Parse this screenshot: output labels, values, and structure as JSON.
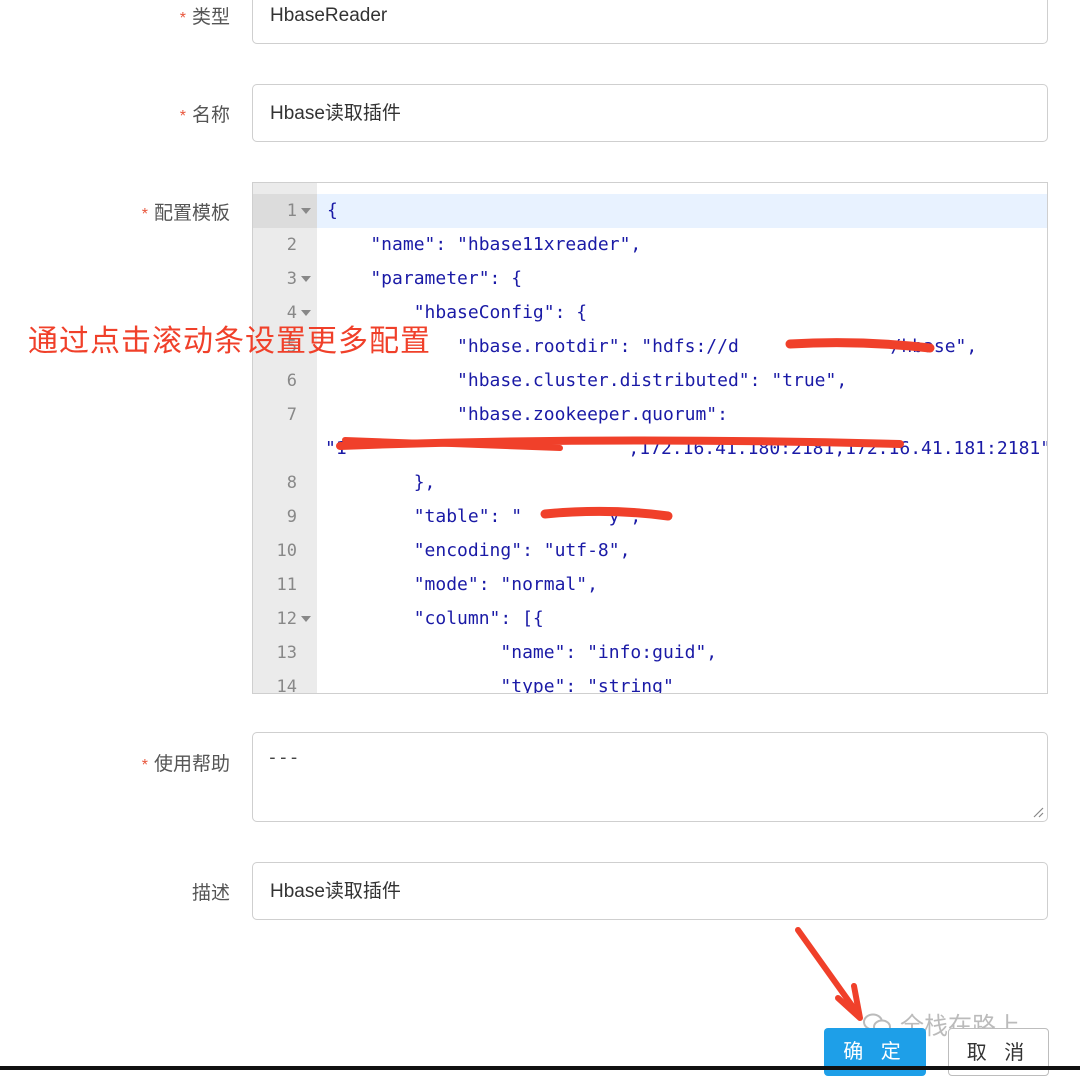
{
  "form": {
    "type": {
      "label": "类型",
      "value": "HbaseReader"
    },
    "name": {
      "label": "名称",
      "value": "Hbase读取插件"
    },
    "template": {
      "label": "配置模板"
    },
    "help": {
      "label": "使用帮助",
      "value": "---"
    },
    "desc": {
      "label": "描述",
      "value": "Hbase读取插件"
    }
  },
  "code_lines": [
    {
      "n": "1",
      "fold": true,
      "text": "{"
    },
    {
      "n": "2",
      "fold": false,
      "text": "    \"name\": \"hbase11xreader\","
    },
    {
      "n": "3",
      "fold": true,
      "text": "    \"parameter\": {"
    },
    {
      "n": "4",
      "fold": true,
      "text": "        \"hbaseConfig\": {"
    },
    {
      "n": "5",
      "fold": false,
      "text": "            \"hbase.rootdir\": \"hdfs://d              /hbase\","
    },
    {
      "n": "6",
      "fold": false,
      "text": "            \"hbase.cluster.distributed\": \"true\","
    },
    {
      "n": "7",
      "fold": false,
      "text": "            \"hbase.zookeeper.quorum\":"
    },
    {
      "n": "",
      "fold": false,
      "text": "\"1                          ,172.16.41.180:2181,172.16.41.181:2181\""
    },
    {
      "n": "8",
      "fold": false,
      "text": "        },"
    },
    {
      "n": "9",
      "fold": false,
      "text": "        \"table\": \"        y\","
    },
    {
      "n": "10",
      "fold": false,
      "text": "        \"encoding\": \"utf-8\","
    },
    {
      "n": "11",
      "fold": false,
      "text": "        \"mode\": \"normal\","
    },
    {
      "n": "12",
      "fold": true,
      "text": "        \"column\": [{"
    },
    {
      "n": "13",
      "fold": false,
      "text": "                \"name\": \"info:guid\","
    },
    {
      "n": "14",
      "fold": false,
      "text": "                \"type\": \"string\""
    }
  ],
  "annotation": "通过点击滚动条设置更多配置",
  "buttons": {
    "ok": "确 定",
    "cancel": "取 消"
  },
  "watermark": "全栈在路上",
  "colors": {
    "accent": "#1e9fe8",
    "annotation": "#f0402a",
    "required": "#e8553b"
  }
}
